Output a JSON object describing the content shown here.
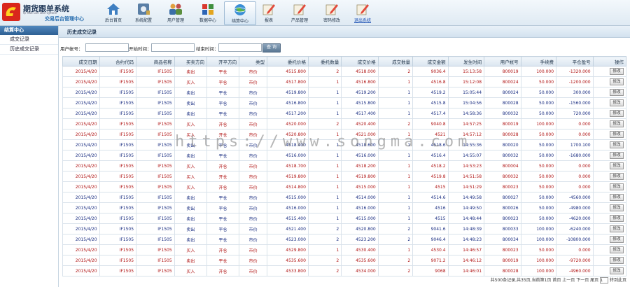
{
  "header": {
    "title": "期货跟单系统",
    "subtitle": "Qi Huo Gen Dan System",
    "tagline": "交易后台管理中心"
  },
  "nav": [
    {
      "label": "后台首页",
      "icon": "home-icon"
    },
    {
      "label": "系统配置",
      "icon": "config-icon"
    },
    {
      "label": "用户管理",
      "icon": "users-icon"
    },
    {
      "label": "数据中心",
      "icon": "puzzle-icon"
    },
    {
      "label": "结算中心",
      "icon": "globe-icon"
    },
    {
      "label": "报表",
      "icon": "pencil-icon"
    },
    {
      "label": "产品管理",
      "icon": "pencil-icon"
    },
    {
      "label": "密码修改",
      "icon": "pencil-icon"
    },
    {
      "label": "退出系统",
      "icon": "pencil-icon"
    }
  ],
  "sidebar": {
    "header": "结算中心",
    "items": [
      "成交记录",
      "历史成交记录"
    ]
  },
  "page": {
    "title": "历史成交记录"
  },
  "search": {
    "account_label": "用户帐号：",
    "start_label": "开始时间：",
    "end_label": "结束时间：",
    "button": "查 询"
  },
  "table": {
    "headers": [
      "成交日期",
      "合约代码",
      "商品名称",
      "买卖方向",
      "开平方向",
      "类型",
      "委托价格",
      "委托数量",
      "成交价格",
      "成交数量",
      "成交金额",
      "发生时间",
      "用户帐号",
      "手续费",
      "平仓盈亏",
      "操作"
    ],
    "edit_label": "修改",
    "rows": [
      [
        "2015/4/20",
        "IF1505",
        "IF1505",
        "卖出",
        "平仓",
        "市价",
        "4515.800",
        "2",
        "4518.000",
        "2",
        "9036.4",
        "15:13:58",
        "800019",
        "100.000",
        "-1320.000",
        "sell"
      ],
      [
        "2015/4/20",
        "IF1505",
        "IF1505",
        "买入",
        "平仓",
        "市价",
        "4517.800",
        "1",
        "4516.800",
        "1",
        "4516.8",
        "15:12:08",
        "800024",
        "50.000",
        "-1200.000",
        "sell"
      ],
      [
        "2015/4/20",
        "IF1505",
        "IF1505",
        "卖出",
        "平仓",
        "市价",
        "4519.800",
        "1",
        "4519.200",
        "1",
        "4519.2",
        "15:05:44",
        "800024",
        "50.000",
        "300.000",
        "buy"
      ],
      [
        "2015/4/20",
        "IF1505",
        "IF1505",
        "卖出",
        "平仓",
        "市价",
        "4516.800",
        "1",
        "4515.800",
        "1",
        "4515.8",
        "15:04:56",
        "800028",
        "50.000",
        "-1560.000",
        "buy"
      ],
      [
        "2015/4/20",
        "IF1505",
        "IF1505",
        "卖出",
        "平仓",
        "市价",
        "4517.200",
        "1",
        "4517.400",
        "1",
        "4517.4",
        "14:58:36",
        "800032",
        "50.000",
        "720.000",
        "buy"
      ],
      [
        "2015/4/20",
        "IF1505",
        "IF1505",
        "买入",
        "开仓",
        "市价",
        "4520.000",
        "2",
        "4520.400",
        "2",
        "9040.8",
        "14:57:25",
        "800019",
        "100.000",
        "0.000",
        "sell"
      ],
      [
        "2015/4/20",
        "IF1505",
        "IF1505",
        "买入",
        "开仓",
        "市价",
        "4520.800",
        "1",
        "4521.000",
        "1",
        "4521",
        "14:57:12",
        "800028",
        "50.000",
        "0.000",
        "sell"
      ],
      [
        "2015/4/20",
        "IF1505",
        "IF1505",
        "卖出",
        "平仓",
        "市价",
        "4518.400",
        "1",
        "4518.600",
        "1",
        "4518.6",
        "14:55:36",
        "800020",
        "50.000",
        "1700.100",
        "buy"
      ],
      [
        "2015/4/20",
        "IF1505",
        "IF1505",
        "卖出",
        "平仓",
        "市价",
        "4516.000",
        "1",
        "4516.000",
        "1",
        "4516.4",
        "14:55:07",
        "800032",
        "50.000",
        "-1680.000",
        "buy"
      ],
      [
        "2015/4/20",
        "IF1505",
        "IF1505",
        "买入",
        "开仓",
        "市价",
        "4518.700",
        "1",
        "4518.200",
        "1",
        "4518.2",
        "14:53:23",
        "800004",
        "50.000",
        "0.000",
        "sell"
      ],
      [
        "2015/4/20",
        "IF1505",
        "IF1505",
        "买入",
        "开仓",
        "市价",
        "4519.800",
        "1",
        "4519.800",
        "1",
        "4519.8",
        "14:51:58",
        "800032",
        "50.000",
        "0.000",
        "sell"
      ],
      [
        "2015/4/20",
        "IF1505",
        "IF1505",
        "买入",
        "开仓",
        "市价",
        "4514.800",
        "1",
        "4515.000",
        "1",
        "4515",
        "14:51:29",
        "800023",
        "50.000",
        "0.000",
        "sell"
      ],
      [
        "2015/4/20",
        "IF1505",
        "IF1505",
        "卖出",
        "平仓",
        "市价",
        "4515.000",
        "1",
        "4514.000",
        "1",
        "4514.6",
        "14:49:58",
        "800027",
        "50.000",
        "-4560.000",
        "buy"
      ],
      [
        "2015/4/20",
        "IF1505",
        "IF1505",
        "卖出",
        "平仓",
        "市价",
        "4516.000",
        "1",
        "4516.000",
        "1",
        "4516",
        "14:49:50",
        "800026",
        "50.000",
        "-4980.000",
        "buy"
      ],
      [
        "2015/4/20",
        "IF1505",
        "IF1505",
        "卖出",
        "平仓",
        "市价",
        "4515.400",
        "1",
        "4515.000",
        "1",
        "4515",
        "14:48:44",
        "800023",
        "50.000",
        "-4620.000",
        "buy"
      ],
      [
        "2015/4/20",
        "IF1505",
        "IF1505",
        "卖出",
        "平仓",
        "市价",
        "4521.400",
        "2",
        "4520.800",
        "2",
        "9041.6",
        "14:48:39",
        "800033",
        "100.000",
        "-6240.000",
        "buy"
      ],
      [
        "2015/4/20",
        "IF1505",
        "IF1505",
        "卖出",
        "平仓",
        "市价",
        "4523.000",
        "2",
        "4523.200",
        "2",
        "9046.4",
        "14:48:23",
        "800034",
        "100.000",
        "-10800.000",
        "buy"
      ],
      [
        "2015/4/20",
        "IF1505",
        "IF1505",
        "买入",
        "开仓",
        "市价",
        "4529.800",
        "1",
        "4530.400",
        "1",
        "4530.4",
        "14:46:57",
        "800023",
        "50.000",
        "0.000",
        "sell"
      ],
      [
        "2015/4/20",
        "IF1505",
        "IF1505",
        "卖出",
        "平仓",
        "市价",
        "4535.600",
        "2",
        "4535.600",
        "2",
        "9071.2",
        "14:46:12",
        "800019",
        "100.000",
        "-9720.000",
        "sell"
      ],
      [
        "2015/4/20",
        "IF1505",
        "IF1505",
        "买入",
        "开仓",
        "市价",
        "4533.800",
        "2",
        "4534.000",
        "2",
        "9068",
        "14:46:01",
        "800028",
        "100.000",
        "-4960.000",
        "sell"
      ]
    ]
  },
  "pager": {
    "summary": "共500条记录,共35页,当前第1页",
    "first": "首页",
    "prev": "上一页",
    "next": "下一页",
    "last": "尾页",
    "goto": "转到此页"
  },
  "watermark": "https://www.songma.com"
}
